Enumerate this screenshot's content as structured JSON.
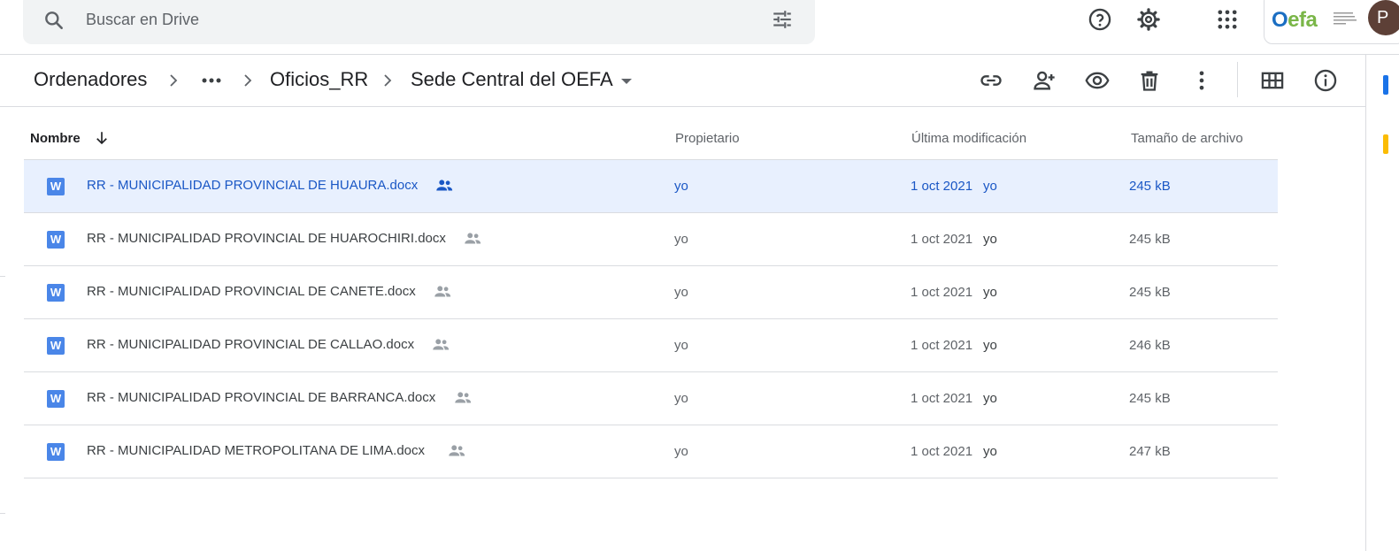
{
  "search": {
    "placeholder": "Buscar en Drive"
  },
  "org": {
    "logo_text_a": "O",
    "logo_text_b": "efa",
    "avatar_letter": "P"
  },
  "breadcrumb": {
    "items": [
      "Ordenadores",
      "Oficios_RR",
      "Sede Central del OEFA"
    ]
  },
  "table": {
    "headers": {
      "name": "Nombre",
      "owner": "Propietario",
      "modified": "Última modificación",
      "size": "Tamaño de archivo"
    },
    "rows": [
      {
        "name": "RR -  MUNICIPALIDAD PROVINCIAL DE HUAURA.docx",
        "owner": "yo",
        "modified_date": "1 oct 2021",
        "modified_by": "yo",
        "size": "245 kB",
        "selected": true
      },
      {
        "name": "RR -  MUNICIPALIDAD PROVINCIAL DE HUAROCHIRI.docx",
        "owner": "yo",
        "modified_date": "1 oct 2021",
        "modified_by": "yo",
        "size": "245 kB",
        "selected": false
      },
      {
        "name": "RR -  MUNICIPALIDAD PROVINCIAL DE CANETE.docx",
        "owner": "yo",
        "modified_date": "1 oct 2021",
        "modified_by": "yo",
        "size": "245 kB",
        "selected": false
      },
      {
        "name": "RR -  MUNICIPALIDAD PROVINCIAL DE CALLAO.docx",
        "owner": "yo",
        "modified_date": "1 oct 2021",
        "modified_by": "yo",
        "size": "246 kB",
        "selected": false
      },
      {
        "name": "RR -  MUNICIPALIDAD PROVINCIAL DE BARRANCA.docx",
        "owner": "yo",
        "modified_date": "1 oct 2021",
        "modified_by": "yo",
        "size": "245 kB",
        "selected": false
      },
      {
        "name": "RR -  MUNICIPALIDAD METROPOLITANA DE LIMA.docx",
        "owner": "yo",
        "modified_date": "1 oct 2021",
        "modified_by": "yo",
        "size": "247 kB",
        "selected": false
      }
    ],
    "file_icon_letter": "W"
  },
  "icons": {
    "search": "search-icon",
    "tune": "tune-icon",
    "help": "help-icon",
    "settings": "gear-icon",
    "apps": "apps-grid-icon",
    "link": "link-icon",
    "share": "add-person-icon",
    "preview": "eye-icon",
    "trash": "trash-icon",
    "more": "more-vert-icon",
    "grid": "grid-view-icon",
    "info": "info-icon",
    "shared": "shared-people-icon",
    "sort": "arrow-down-icon"
  },
  "colors": {
    "accent": "#1a73e8",
    "selected_bg": "#e8f0fe",
    "selected_text": "#1a57c5",
    "word_blue": "#4a86e8"
  }
}
